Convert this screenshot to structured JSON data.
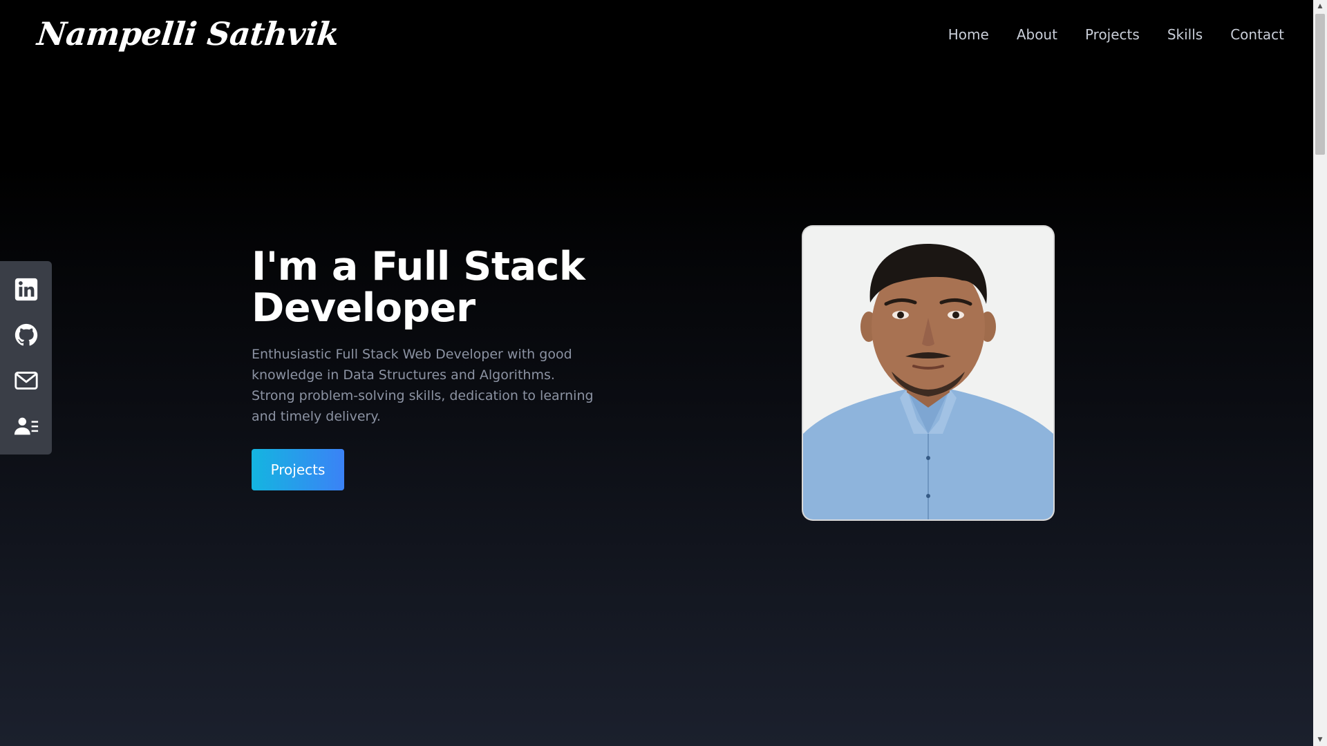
{
  "header": {
    "logo": "Nampelli Sathvik",
    "nav": [
      "Home",
      "About",
      "Projects",
      "Skills",
      "Contact"
    ]
  },
  "social": {
    "icons": [
      "linkedin-icon",
      "github-icon",
      "mail-icon",
      "contact-card-icon"
    ]
  },
  "hero": {
    "title": "I'm a Full Stack Developer",
    "description": "Enthusiastic Full Stack Web Developer with good knowledge in Data Structures and Algorithms. Strong problem-solving skills, dedication to learning and timely delivery.",
    "cta_label": "Projects"
  },
  "colors": {
    "accent_start": "#14b5e0",
    "accent_end": "#3b82f6",
    "social_rail": "#3a3e47"
  }
}
